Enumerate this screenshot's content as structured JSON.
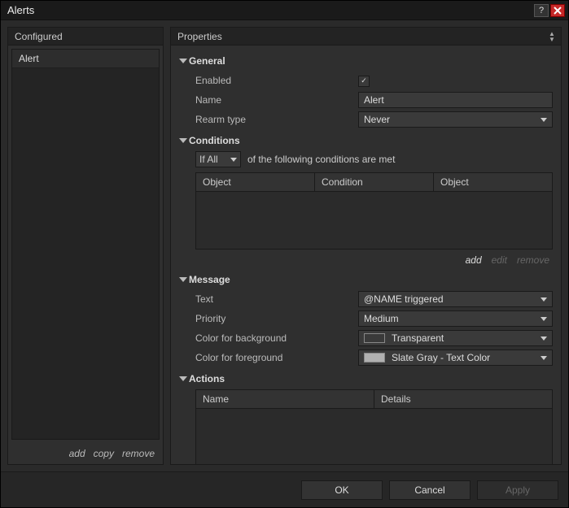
{
  "window": {
    "title": "Alerts"
  },
  "left": {
    "header": "Configured",
    "items": [
      {
        "label": "Alert"
      }
    ],
    "actions": {
      "add": "add",
      "copy": "copy",
      "remove": "remove"
    }
  },
  "right": {
    "header": "Properties",
    "general": {
      "title": "General",
      "enabled_label": "Enabled",
      "enabled": true,
      "name_label": "Name",
      "name_value": "Alert",
      "rearm_label": "Rearm type",
      "rearm_value": "Never"
    },
    "conditions": {
      "title": "Conditions",
      "logic": "If All",
      "suffix": "of the following conditions are met",
      "columns": [
        "Object",
        "Condition",
        "Object"
      ],
      "actions": {
        "add": "add",
        "edit": "edit",
        "remove": "remove"
      }
    },
    "message": {
      "title": "Message",
      "text_label": "Text",
      "text_value": "@NAME triggered",
      "priority_label": "Priority",
      "priority_value": "Medium",
      "bg_label": "Color for background",
      "bg_value": "Transparent",
      "bg_swatch": "#ffffff00",
      "fg_label": "Color for foreground",
      "fg_value": "Slate Gray - Text Color",
      "fg_swatch": "#b0b0b0"
    },
    "actions_section": {
      "title": "Actions",
      "columns": [
        "Name",
        "Details"
      ]
    }
  },
  "footer": {
    "ok": "OK",
    "cancel": "Cancel",
    "apply": "Apply"
  }
}
